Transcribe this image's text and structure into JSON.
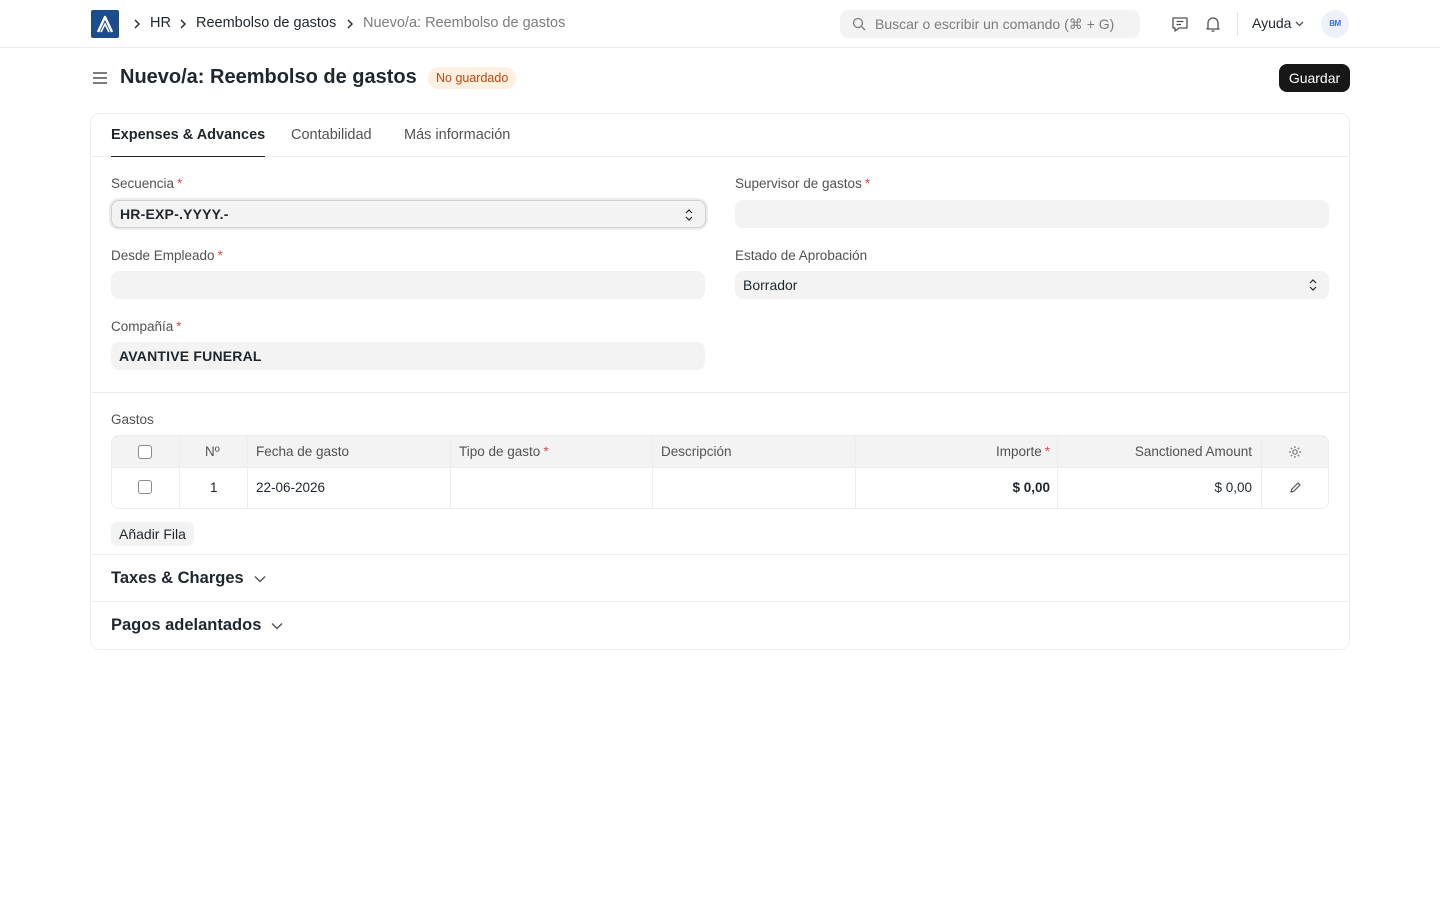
{
  "navbar": {
    "breadcrumbs": [
      "HR",
      "Reembolso de gastos",
      "Nuevo/a: Reembolso de gastos"
    ],
    "search_placeholder": "Buscar o escribir un comando (⌘ + G)",
    "help_label": "Ayuda",
    "avatar_text": "BM"
  },
  "page": {
    "title": "Nuevo/a: Reembolso de gastos",
    "status": "No guardado",
    "save_label": "Guardar"
  },
  "tabs": [
    "Expenses & Advances",
    "Contabilidad",
    "Más información"
  ],
  "form": {
    "secuencia": {
      "label": "Secuencia",
      "value": "HR-EXP-.YYYY.-"
    },
    "supervisor": {
      "label": "Supervisor de gastos",
      "value": ""
    },
    "empleado": {
      "label": "Desde Empleado",
      "value": ""
    },
    "estado": {
      "label": "Estado de Aprobación",
      "value": "Borrador"
    },
    "compania": {
      "label": "Compañía",
      "value": "AVANTIVE FUNERAL"
    }
  },
  "expenses": {
    "section_label": "Gastos",
    "columns": [
      "Nº",
      "Fecha de gasto",
      "Tipo de gasto",
      "Descripción",
      "Importe",
      "Sanctioned Amount"
    ],
    "rows": [
      {
        "no": "1",
        "fecha": "22-06-2026",
        "tipo": "",
        "descripcion": "",
        "importe": "$ 0,00",
        "sancionado": "$ 0,00"
      }
    ],
    "add_row_label": "Añadir Fila"
  },
  "sections": {
    "taxes": "Taxes & Charges",
    "advances": "Pagos adelantados"
  },
  "colors": {
    "primary": "#171717",
    "logo": "#1d4c8c",
    "status_bg": "#fff0e2",
    "status_text": "#c4470e",
    "required": "#e24c4c"
  }
}
